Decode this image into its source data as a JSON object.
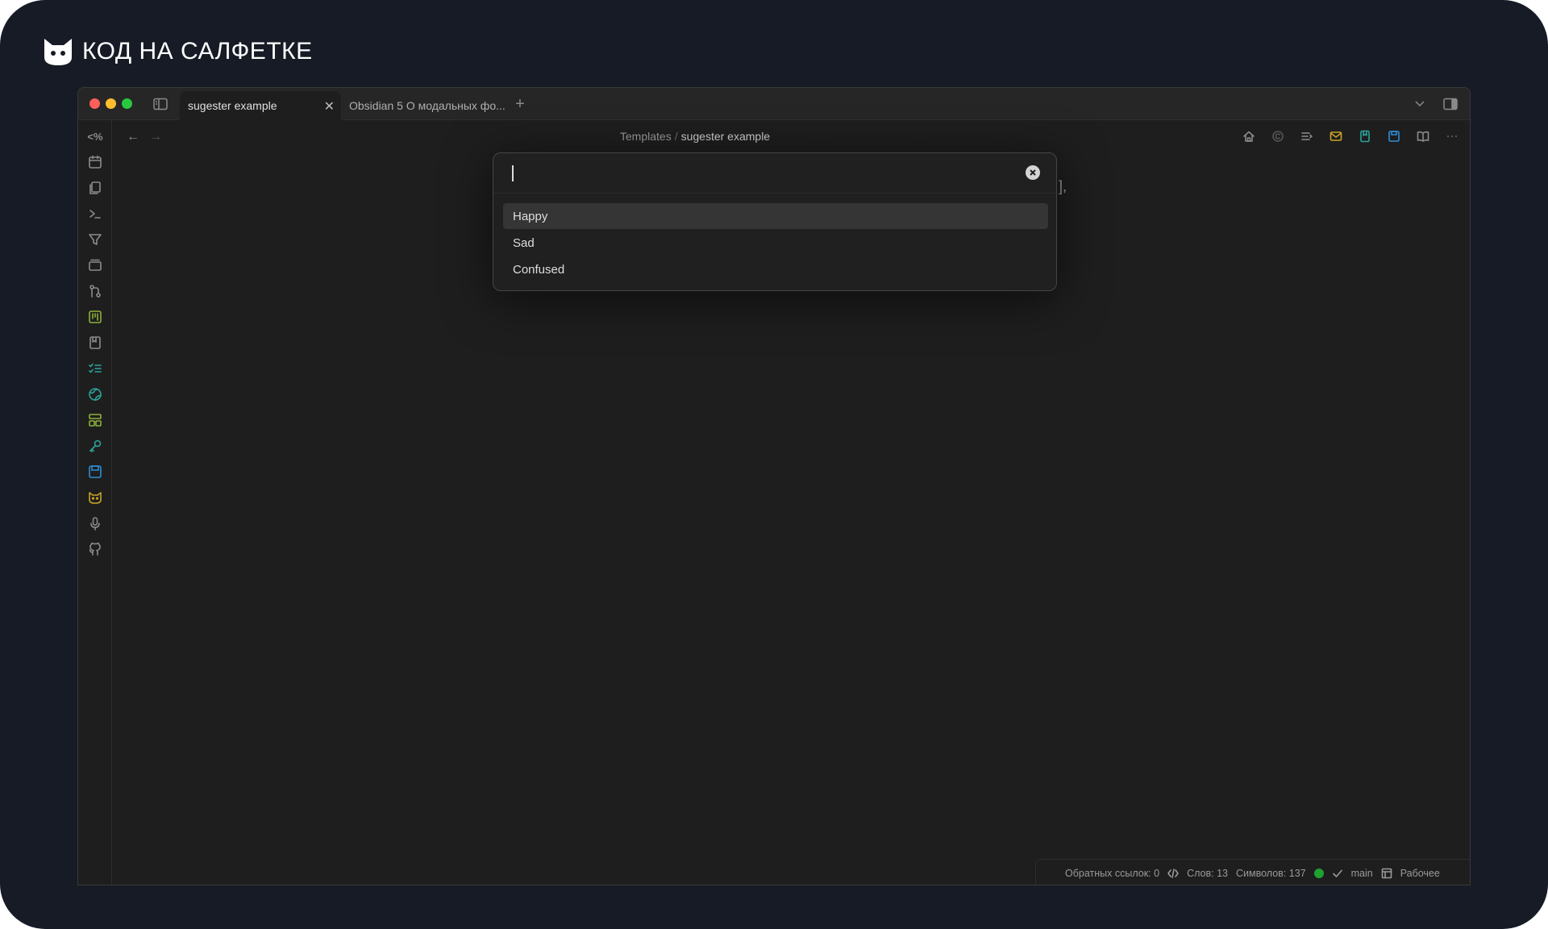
{
  "brand": {
    "name": "КОД НА САЛФЕТКЕ"
  },
  "tabs": [
    {
      "label": "sugester example",
      "active": true
    },
    {
      "label": "Obsidian 5 О модальных фо...",
      "active": false
    }
  ],
  "breadcrumb": {
    "folder": "Templates",
    "separator": "/",
    "current": "sugester example"
  },
  "editor": {
    "partial_text": "],",
    "note": ""
  },
  "modal": {
    "input_value": "",
    "options": [
      "Happy",
      "Sad",
      "Confused"
    ],
    "selected_index": 0
  },
  "ribbon": {
    "template_label": "<%"
  },
  "status_bar": {
    "backlinks": "Обратных ссылок: 0",
    "words": "Слов: 13",
    "chars": "Символов: 137",
    "branch": "main",
    "workspace": "Рабочее"
  },
  "colors": {
    "frame_bg": "#161b26",
    "window_bg": "#1e1e1e",
    "sync_dot": "#1ea130",
    "accent_green": "#8db13a",
    "accent_teal": "#2ba39a",
    "accent_blue": "#2d8fd5",
    "accent_yellow": "#c9a227"
  },
  "icons": {
    "ribbon": [
      "calendar-icon",
      "files-icon",
      "terminal-icon",
      "filter-icon",
      "slides-icon",
      "git-icon",
      "kanban-icon",
      "bookmark-icon",
      "checklist-icon",
      "globe-icon",
      "layout-icon",
      "key-icon",
      "save-icon",
      "cat-icon",
      "microphone-icon",
      "github-icon"
    ],
    "toolbar": [
      "home-icon",
      "copyright-icon",
      "outline-icon",
      "mail-icon",
      "bookmark-icon",
      "save-icon",
      "book-open-icon",
      "more-icon"
    ]
  }
}
